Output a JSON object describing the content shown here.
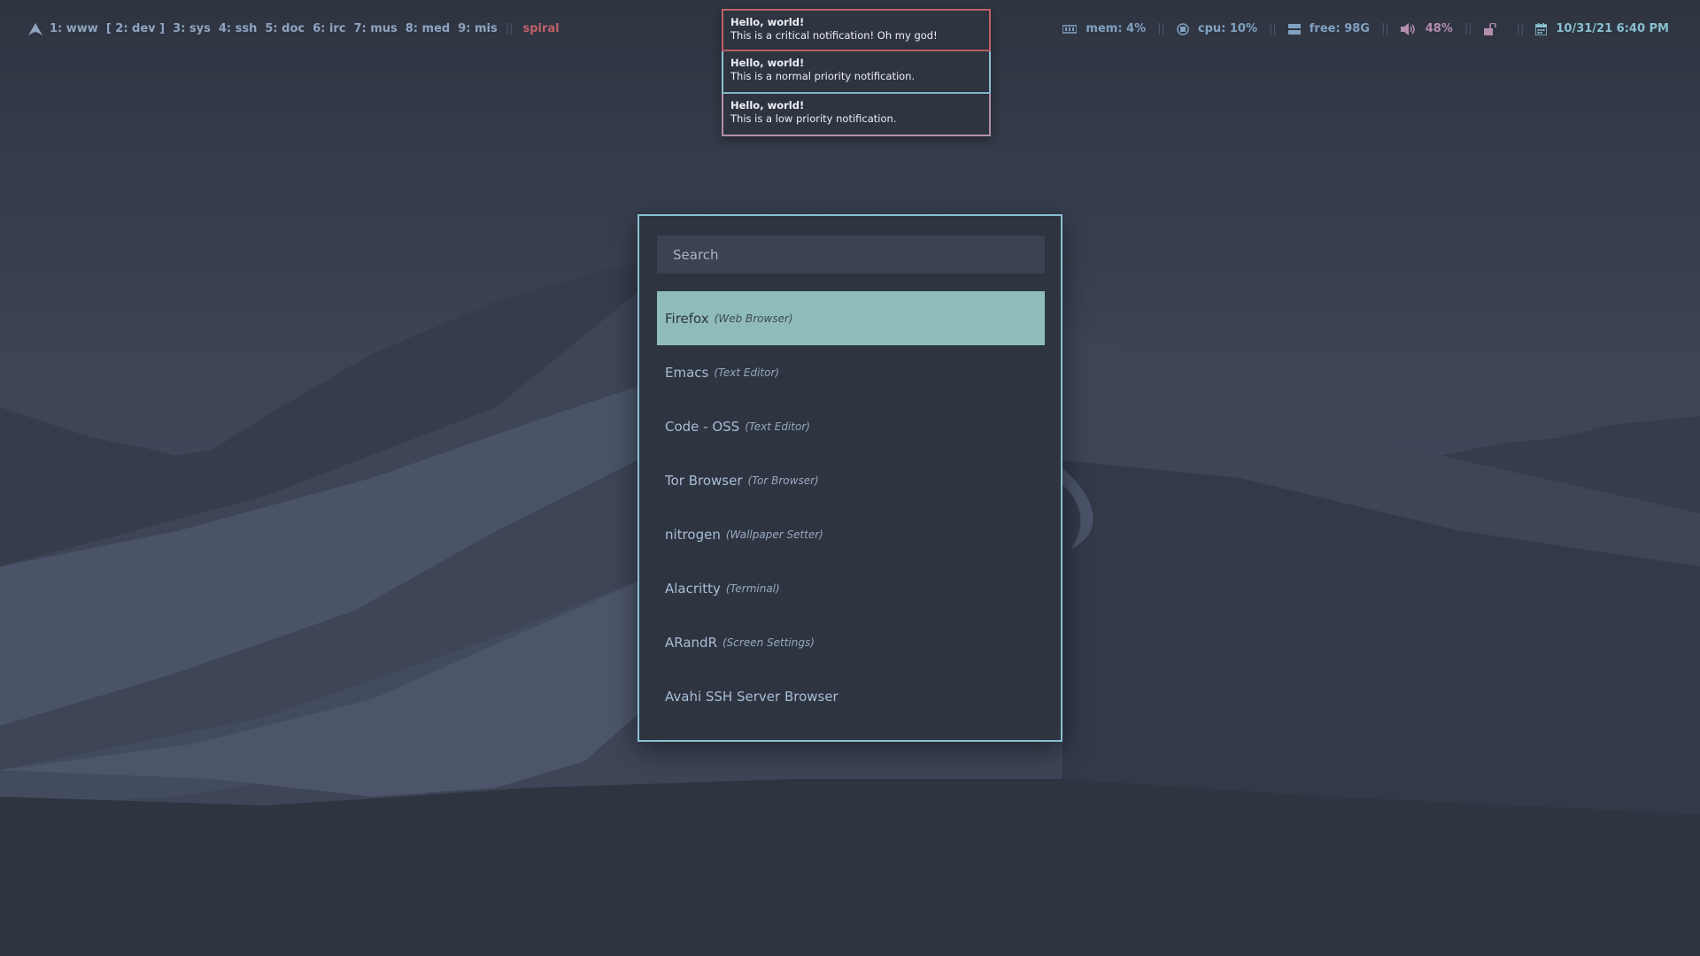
{
  "bar": {
    "workspaces": [
      {
        "label": "1: www"
      },
      {
        "label": "[ 2: dev ]"
      },
      {
        "label": "3: sys"
      },
      {
        "label": "4: ssh"
      },
      {
        "label": "5: doc"
      },
      {
        "label": "6: irc"
      },
      {
        "label": "7: mus"
      },
      {
        "label": "8: med"
      },
      {
        "label": "9: mis"
      }
    ],
    "separator": "||",
    "layout": "spiral",
    "modules": {
      "mem": "mem: 4%",
      "cpu": "cpu: 10%",
      "disk": "free: 98G",
      "volume": "48%",
      "datetime": "10/31/21 6:40 PM"
    }
  },
  "notifications": [
    {
      "title": "Hello, world!",
      "body": "This is a critical notification! Oh my god!",
      "urgency": "critical"
    },
    {
      "title": "Hello, world!",
      "body": "This is a normal priority notification.",
      "urgency": "normal"
    },
    {
      "title": "Hello, world!",
      "body": "This is a low priority notification.",
      "urgency": "low"
    }
  ],
  "launcher": {
    "search": {
      "placeholder": "Search",
      "value": ""
    },
    "results": [
      {
        "name": "Firefox",
        "desc": "(Web Browser)",
        "selected": true
      },
      {
        "name": "Emacs",
        "desc": "(Text Editor)"
      },
      {
        "name": "Code - OSS",
        "desc": "(Text Editor)"
      },
      {
        "name": "Tor Browser",
        "desc": "(Tor Browser)"
      },
      {
        "name": "nitrogen",
        "desc": "(Wallpaper Setter)"
      },
      {
        "name": "Alacritty",
        "desc": "(Terminal)"
      },
      {
        "name": "ARandR",
        "desc": "(Screen Settings)"
      },
      {
        "name": "Avahi SSH Server Browser",
        "desc": ""
      }
    ]
  },
  "colors": {
    "background": "#2e3440",
    "accent": "#88c0d0",
    "selection": "#8fbcbb",
    "critical": "#bf616a",
    "low": "#b48ead"
  }
}
